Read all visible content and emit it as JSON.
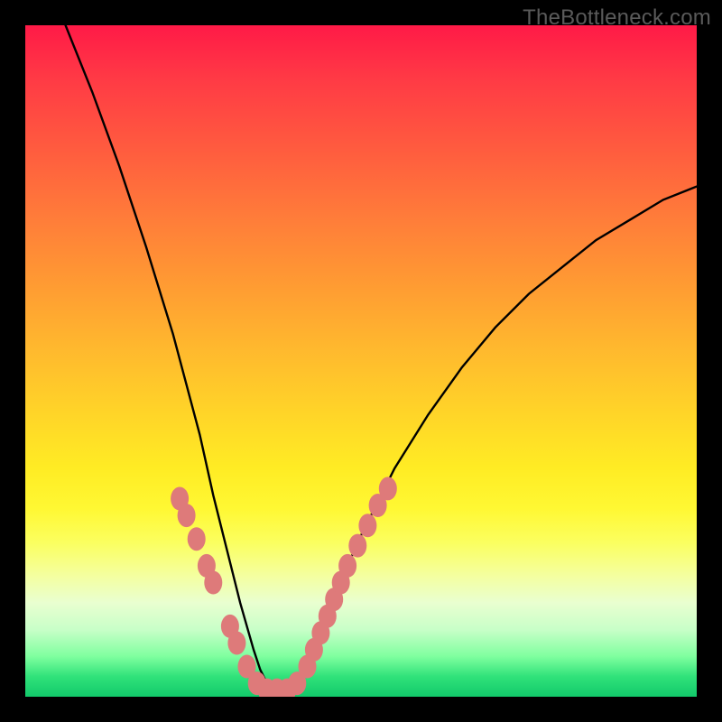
{
  "watermark": "TheBottleneck.com",
  "chart_data": {
    "type": "line",
    "title": "",
    "xlabel": "",
    "ylabel": "",
    "xlim": [
      0,
      100
    ],
    "ylim": [
      0,
      100
    ],
    "series": [
      {
        "name": "bottleneck-curve",
        "x": [
          6,
          10,
          14,
          18,
          22,
          26,
          28,
          30,
          32,
          34,
          35,
          36,
          37,
          38,
          39,
          40,
          42,
          44,
          46,
          50,
          55,
          60,
          65,
          70,
          75,
          80,
          85,
          90,
          95,
          100
        ],
        "y": [
          100,
          90,
          79,
          67,
          54,
          39,
          30,
          22,
          14,
          7,
          4,
          2,
          1,
          1,
          1,
          2,
          5,
          10,
          15,
          24,
          34,
          42,
          49,
          55,
          60,
          64,
          68,
          71,
          74,
          76
        ]
      }
    ],
    "markers": {
      "name": "highlight-beads",
      "color": "#de7a7a",
      "points": [
        {
          "x": 23.0,
          "y": 29.5
        },
        {
          "x": 24.0,
          "y": 27.0
        },
        {
          "x": 25.5,
          "y": 23.5
        },
        {
          "x": 27.0,
          "y": 19.5
        },
        {
          "x": 28.0,
          "y": 17.0
        },
        {
          "x": 30.5,
          "y": 10.5
        },
        {
          "x": 31.5,
          "y": 8.0
        },
        {
          "x": 33.0,
          "y": 4.5
        },
        {
          "x": 34.5,
          "y": 2.0
        },
        {
          "x": 36.0,
          "y": 1.0
        },
        {
          "x": 37.5,
          "y": 1.0
        },
        {
          "x": 39.0,
          "y": 1.0
        },
        {
          "x": 40.5,
          "y": 2.0
        },
        {
          "x": 42.0,
          "y": 4.5
        },
        {
          "x": 43.0,
          "y": 7.0
        },
        {
          "x": 44.0,
          "y": 9.5
        },
        {
          "x": 45.0,
          "y": 12.0
        },
        {
          "x": 46.0,
          "y": 14.5
        },
        {
          "x": 47.0,
          "y": 17.0
        },
        {
          "x": 48.0,
          "y": 19.5
        },
        {
          "x": 49.5,
          "y": 22.5
        },
        {
          "x": 51.0,
          "y": 25.5
        },
        {
          "x": 52.5,
          "y": 28.5
        },
        {
          "x": 54.0,
          "y": 31.0
        }
      ]
    }
  }
}
